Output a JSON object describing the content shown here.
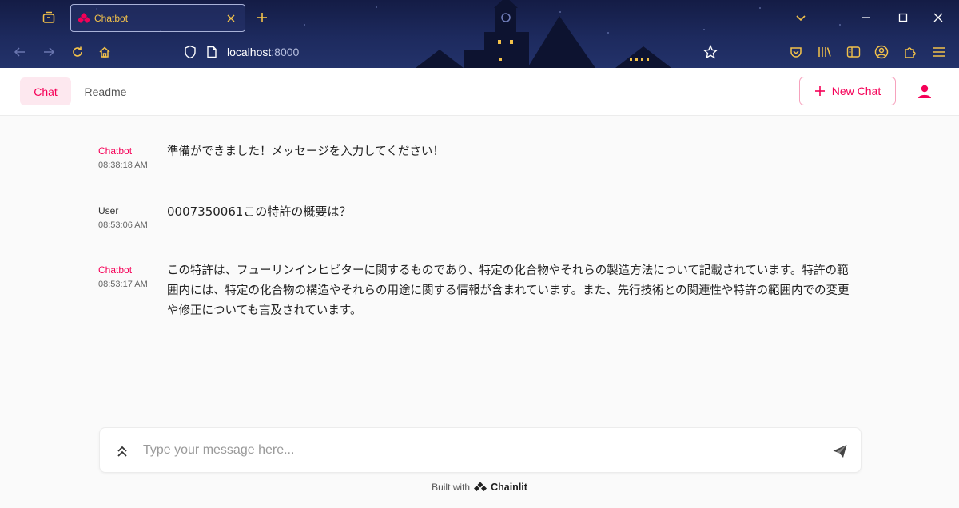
{
  "browser": {
    "tab_title": "Chatbot",
    "url_host": "localhost",
    "url_port": ":8000"
  },
  "header": {
    "nav": [
      {
        "label": "Chat",
        "active": true
      },
      {
        "label": "Readme",
        "active": false
      }
    ],
    "new_chat_label": "New Chat",
    "accent": "#f50057"
  },
  "messages": [
    {
      "author": "Chatbot",
      "time": "08:38:18 AM",
      "text": "準備ができました！メッセージを入力してください！"
    },
    {
      "author": "User",
      "time": "08:53:06 AM",
      "text": "0007350061この特許の概要は？"
    },
    {
      "author": "Chatbot",
      "time": "08:53:17 AM",
      "text": "この特許は、フューリンインヒビターに関するものであり、特定の化合物やそれらの製造方法について記載されています。特許の範囲内には、特定の化合物の構造やそれらの用途に関する情報が含まれています。また、先行技術との関連性や特許の範囲内での変更や修正についても言及されています。"
    }
  ],
  "composer": {
    "placeholder": "Type your message here..."
  },
  "footer": {
    "built_with": "Built with",
    "brand": "Chainlit"
  }
}
